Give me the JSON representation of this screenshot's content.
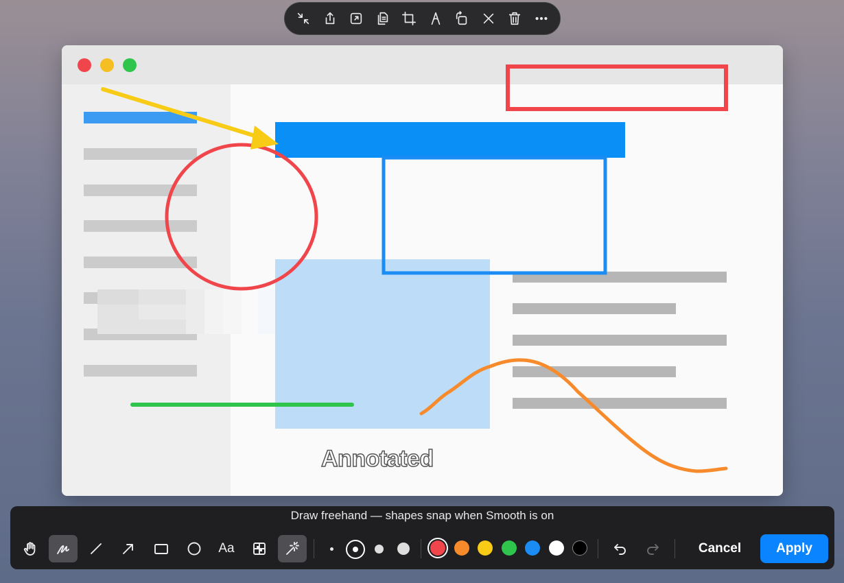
{
  "top_toolbar": {
    "icons": [
      "shrink-icon",
      "share-icon",
      "open-external-icon",
      "copy-icon",
      "crop-icon",
      "markup-pen-icon",
      "rotate-icon",
      "close-icon",
      "trash-icon",
      "more-icon"
    ]
  },
  "canvas": {
    "annotation_text": "Annotated"
  },
  "bottom_toolbar": {
    "hint": "Draw freehand — shapes snap when Smooth is on",
    "tools": [
      "hand-tool",
      "pen-tool",
      "line-tool",
      "arrow-tool",
      "rectangle-tool",
      "ellipse-tool",
      "text-tool",
      "pixelate-tool",
      "smooth-tool"
    ],
    "text_tool_label": "Aa",
    "active_tool": "pen-tool",
    "smooth_enabled": true,
    "stroke_sizes": [
      "small",
      "medium",
      "large",
      "x-large"
    ],
    "selected_stroke_size": "medium",
    "colors": [
      "#f0454a",
      "#f78b2c",
      "#f8cb16",
      "#2fc54c",
      "#1a8cf4",
      "#ffffff",
      "#000000"
    ],
    "selected_color": "#f0454a",
    "cancel_label": "Cancel",
    "apply_label": "Apply"
  }
}
